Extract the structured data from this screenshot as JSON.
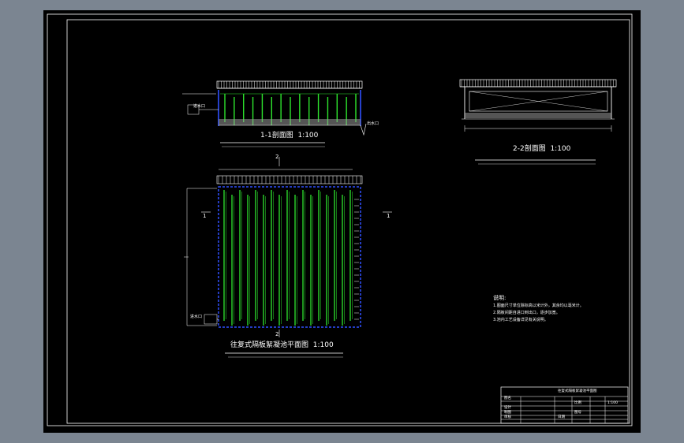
{
  "colors": {
    "background": "#7b8591",
    "sheet": "#000000",
    "line": "#ffffff",
    "wall": "#3050ff",
    "baffle": "#2ee62e",
    "sludge": "#9a9a9a"
  },
  "section_1_1": {
    "title": "1-1剖面图",
    "scale": "1:100",
    "outlet_label": "出水口",
    "inlet_label": "进水口"
  },
  "section_2_2": {
    "title": "2-2剖面图",
    "scale": "1:100"
  },
  "plan": {
    "title": "往复式隔板絮凝池平面图",
    "scale": "1:100",
    "inlet_label": "进水口"
  },
  "markers": {
    "cut_1_left": "1",
    "cut_1_right": "1",
    "cut_2_top": "2",
    "cut_2_bottom": "2"
  },
  "notes": {
    "heading": "说明:",
    "lines": [
      "1.图面尺寸单位除标高以米计外，其余均以毫米计。",
      "2.隔板间距自进口到出口，逐步加宽。",
      "3.池内工艺设备详见有关说明。"
    ]
  },
  "title_block": {
    "project": "往复式隔板絮凝池平面图",
    "cells": [
      "图名",
      "设计",
      "制图",
      "审核",
      "比例",
      "1:100",
      "图号",
      "日期"
    ]
  }
}
